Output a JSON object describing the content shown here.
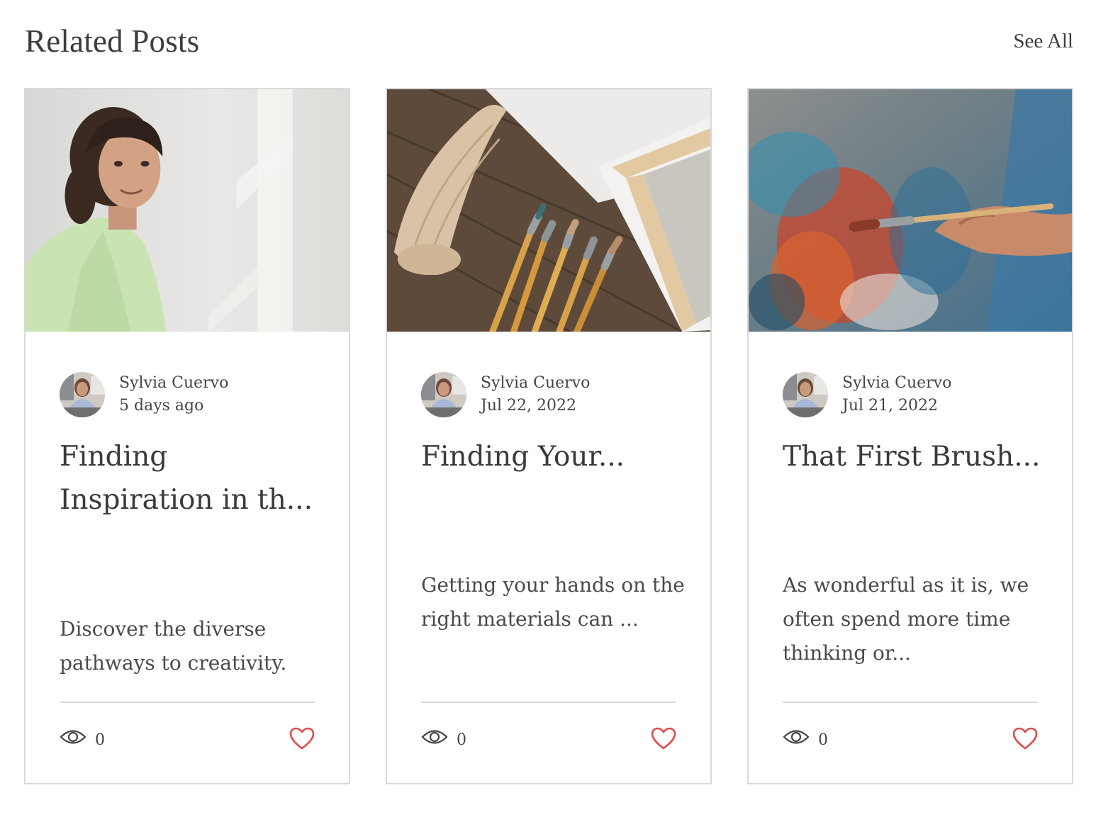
{
  "header": {
    "title": "Related Posts",
    "see_all": "See All"
  },
  "posts": [
    {
      "author": "Sylvia Cuervo",
      "date": "5 days ago",
      "title": "Finding Inspiration in th...",
      "excerpt": "Discover the diverse pathways to creativity.",
      "views": "0",
      "image": "woman-portrait-photo"
    },
    {
      "author": "Sylvia Cuervo",
      "date": "Jul 22, 2022",
      "title": "Finding Your...",
      "excerpt": "Getting your hands on the right materials can ...",
      "views": "0",
      "image": "canvas-and-brushes-photo"
    },
    {
      "author": "Sylvia Cuervo",
      "date": "Jul 21, 2022",
      "title": "That First Brush...",
      "excerpt": "As wonderful as it is, we often spend more time thinking or...",
      "views": "0",
      "image": "painting-hand-photo"
    }
  ],
  "icons": {
    "views": "eye-icon",
    "like": "heart-icon"
  },
  "colors": {
    "heart": "#e04b4b",
    "text": "#3b3b3b",
    "border": "#d9d9d9"
  }
}
